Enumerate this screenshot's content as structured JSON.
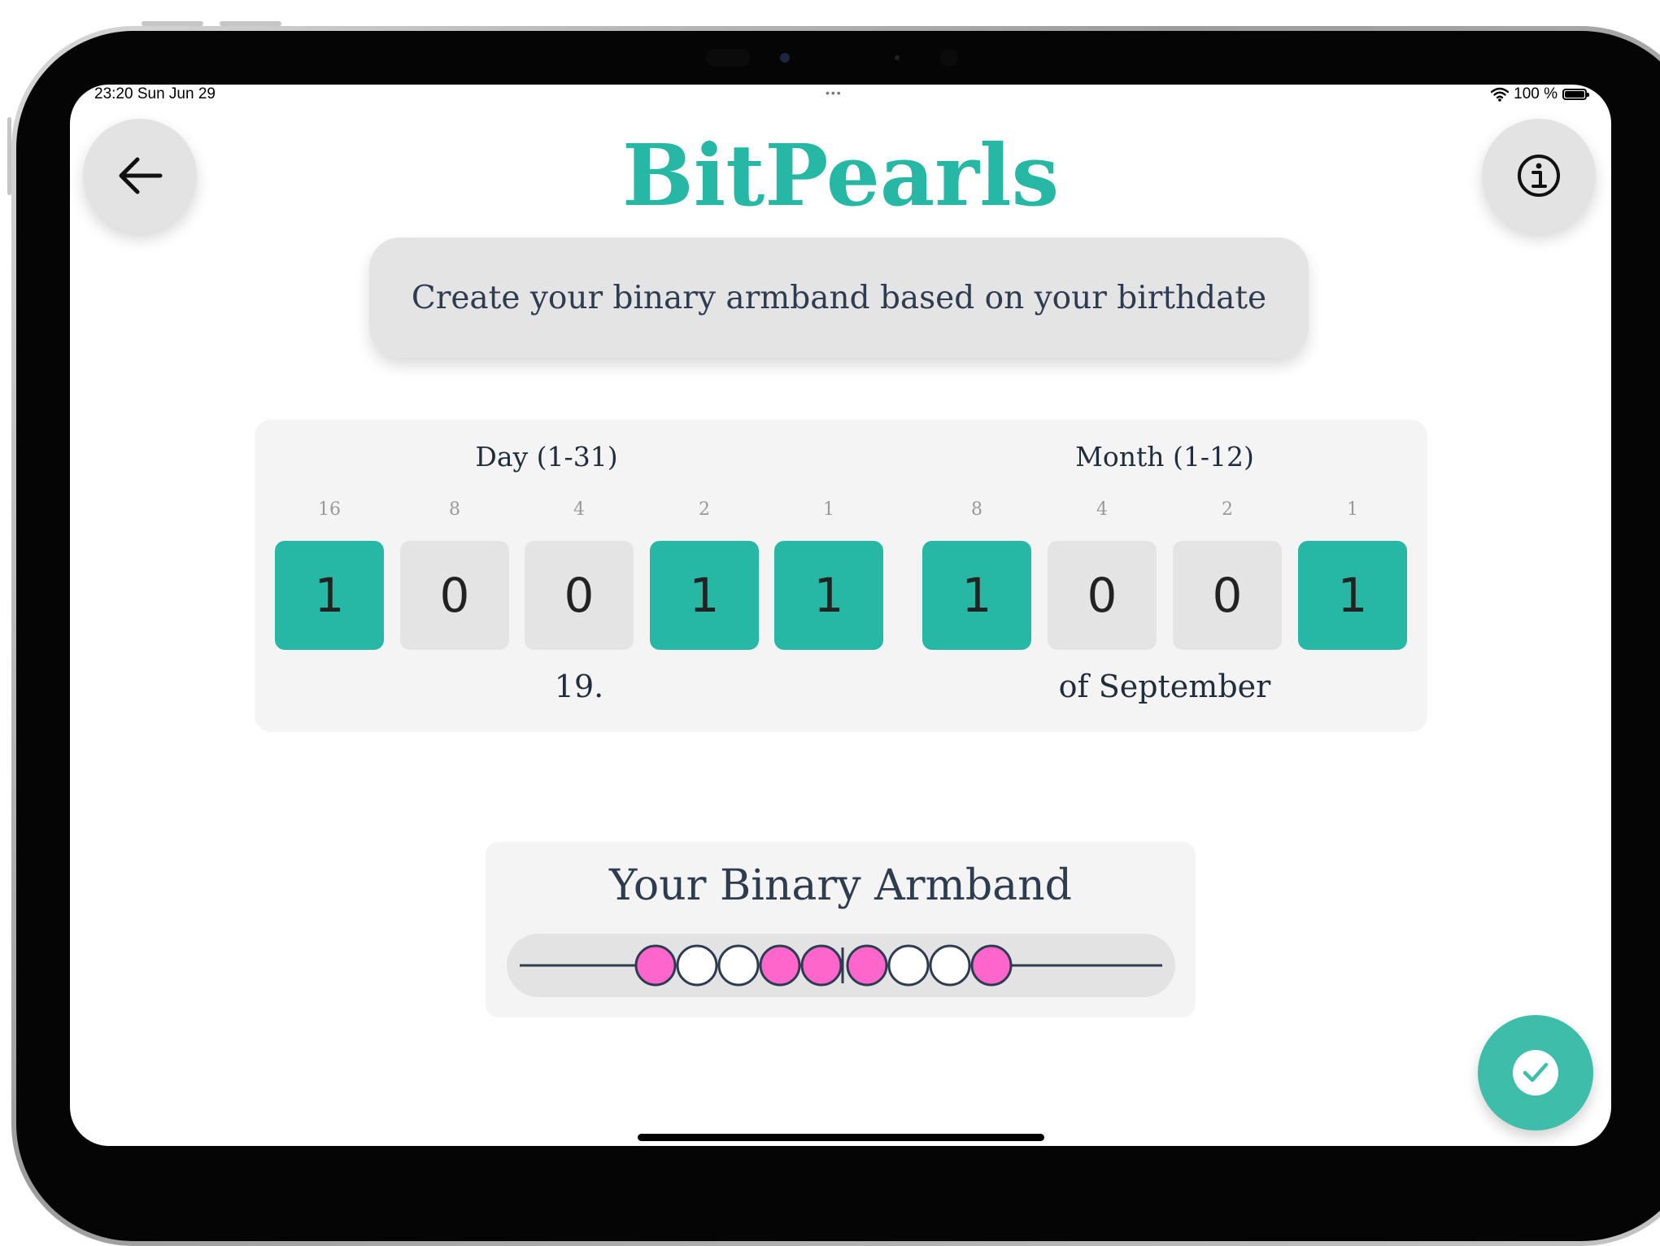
{
  "status_bar": {
    "time_date": "23:20  Sun Jun 29",
    "multitask_dots": "•••",
    "battery_text": "100 %"
  },
  "header": {
    "app_title": "BitPearls",
    "back_icon": "arrow-left-icon",
    "info_icon": "info-icon"
  },
  "subtitle": "Create your binary armband based on your birthdate",
  "day_group": {
    "label": "Day (1-31)",
    "weights": [
      "16",
      "8",
      "4",
      "2",
      "1"
    ],
    "bits": [
      "1",
      "0",
      "0",
      "1",
      "1"
    ],
    "value_text": "19."
  },
  "month_group": {
    "label": "Month (1-12)",
    "weights": [
      "8",
      "4",
      "2",
      "1"
    ],
    "bits": [
      "1",
      "0",
      "0",
      "1"
    ],
    "value_text": "of September"
  },
  "armband": {
    "title": "Your Binary Armband",
    "day_pearls": [
      1,
      0,
      0,
      1,
      1
    ],
    "month_pearls": [
      1,
      0,
      0,
      1
    ]
  },
  "confirm_icon": "checkmark-icon",
  "colors": {
    "accent": "#27b8a5",
    "pearl_on": "#ff66cc",
    "pearl_off": "#ffffff",
    "text_dark": "#2d3c50"
  }
}
